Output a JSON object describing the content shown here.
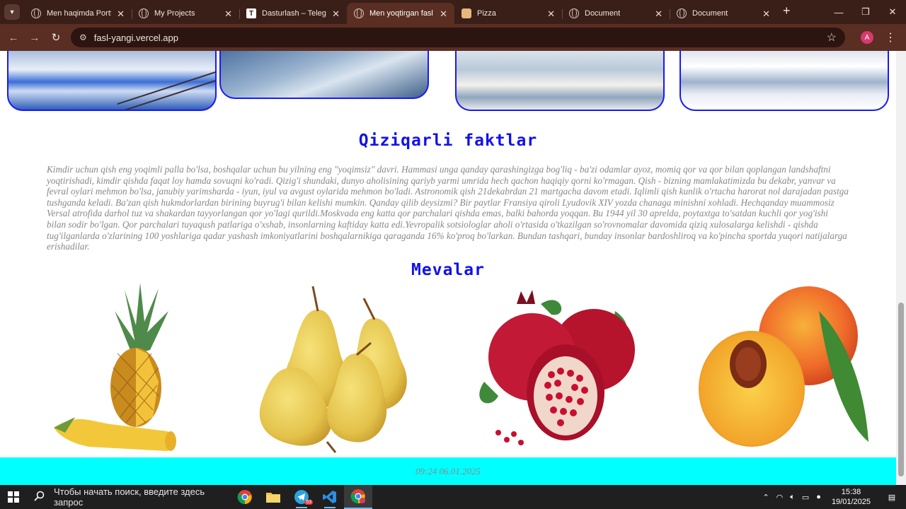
{
  "browser": {
    "tabs": [
      {
        "title": "Men haqimda Portfolio",
        "icon": "globe-icon",
        "active": false
      },
      {
        "title": "My Projects",
        "icon": "globe-icon",
        "active": false
      },
      {
        "title": "Dasturlash – Telegraph",
        "icon": "telegraph-icon",
        "active": false
      },
      {
        "title": "Men yoqtirgan fasl",
        "icon": "globe-icon",
        "active": true
      },
      {
        "title": "Pizza",
        "icon": "pizza-icon",
        "active": false
      },
      {
        "title": "Document",
        "icon": "globe-icon",
        "active": false
      },
      {
        "title": "Document",
        "icon": "globe-icon",
        "active": false
      }
    ],
    "url": "fasl-yangi.vercel.app",
    "profile_initial": "A"
  },
  "page": {
    "facts_title": "Qiziqarli faktlar",
    "facts_text": "Kimdir uchun qish eng yoqimli palla bo'lsa, boshqalar uchun bu yilning eng \"yoqimsiz\" davri. Hammasi unga qanday qarashingizga bog'liq - ba'zi odamlar ayoz, momiq qor va qor bilan qoplangan landshaftni yoqtirishadi, kimdir qishda faqat loy hamda sovuqni ko'radi. Qizig'i shundaki, dunyo aholisining qariyb yarmi umrida hech qachon haqiqiy qorni ko'rmagan. Qish - bizning mamlakatimizda bu dekabr, yanvar va fevral oylari mehmon bo'lsa, janubiy yarimsharda - iyun, iyul va avgust oylarida mehmon bo'ladi. Astronomik qish 21dekabrdan 21 martgacha davom etadi. Iqlimli qish kunlik o'rtacha harorat nol darajadan pastga tushganda keladi. Ba'zan qish hukmdorlardan birining buyrug'i bilan kelishi mumkin. Qanday qilib deysizmi? Bir paytlar Fransiya qiroli Lyudovik XIV yozda chanaga minishni xohladi. Hechqanday muammosiz Versal atrofida darhol tuz va shakardan tayyorlangan qor yo'lagi qurildi.Moskvada eng katta qor parchalari qishda emas, balki bahorda yoqqan. Bu 1944 yil 30 aprelda, poytaxtga to'satdan kuchli qor yog'ishi bilan sodir bo'lgan. Qor parchalari tuyaqush patlariga o'xshab, insonlarning kaftiday katta edi.Yevropalik sotsiologlar aholi o'rtasida o'tkazilgan so'rovnomalar davomida qiziq xulosalarga kelishdi - qishda tug'ilganlarda o'zlarining 100 yoshlariga qadar yashash imkoniyatlarini boshqalarnikiga qaraganda 16% ko'proq bo'larkan. Bundan tashqari, bunday insonlar bardoshliroq va ko'pincha sportda yuqori natijalarga erishadilar.",
    "fruits_title": "Mevalar",
    "footer_text": "09:24 06.01.2025"
  },
  "taskbar": {
    "search_placeholder": "Чтобы начать поиск, введите здесь запрос",
    "telegram_badge": "53",
    "time": "15:38",
    "date": "19/01/2025"
  },
  "colors": {
    "heading": "#1111ee",
    "footer_bg": "#00ffff",
    "card_border": "#1a1af5"
  }
}
